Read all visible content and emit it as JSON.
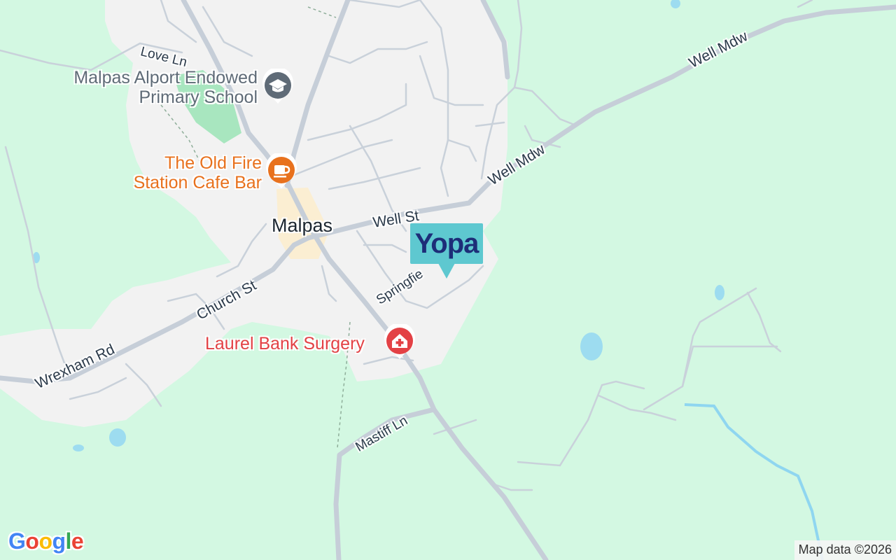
{
  "map": {
    "background_color": "#d3f8e2",
    "town": {
      "name": "Malpas"
    },
    "roads": [
      {
        "id": "well-mdw-east",
        "label": "Well Mdw"
      },
      {
        "id": "well-mdw-mid",
        "label": "Well Mdw"
      },
      {
        "id": "well-st",
        "label": "Well St"
      },
      {
        "id": "love-ln",
        "label": "Love Ln"
      },
      {
        "id": "church-st",
        "label": "Church St"
      },
      {
        "id": "wrexham-rd",
        "label": "Wrexham Rd"
      },
      {
        "id": "springfield",
        "label": "Springfie"
      },
      {
        "id": "mastiff-ln",
        "label": "Mastiff Ln"
      }
    ],
    "pois": [
      {
        "id": "school",
        "name": "Malpas Alport Endowed Primary School",
        "lines": [
          "Malpas Alport Endowed",
          "Primary School"
        ],
        "icon": "school-icon",
        "color": "#5f6b77"
      },
      {
        "id": "cafe",
        "name": "The Old Fire Station Cafe Bar",
        "lines": [
          "The Old Fire",
          "Station Cafe Bar"
        ],
        "icon": "cafe-icon",
        "color": "#e8711d"
      },
      {
        "id": "surgery",
        "name": "Laurel Bank Surgery",
        "lines": [
          "Laurel Bank Surgery"
        ],
        "icon": "hospital-icon",
        "color": "#e34145"
      }
    ],
    "property_marker": {
      "brand": "Yopa",
      "text": "Yopa",
      "color": "#5ec8d0",
      "text_color": "#1d2d78"
    }
  },
  "footer": {
    "logo_text": "Google",
    "attribution": "Map data ©2026"
  }
}
